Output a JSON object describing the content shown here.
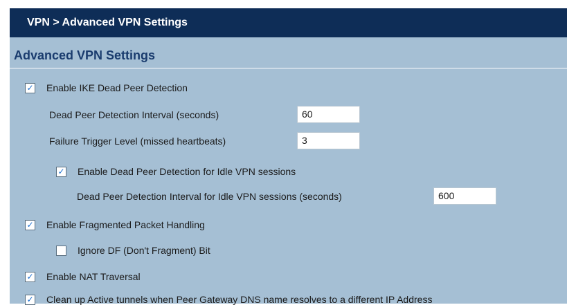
{
  "header": {
    "title": "VPN > Advanced VPN Settings"
  },
  "section": {
    "title": "Advanced VPN Settings"
  },
  "ike_dpd": {
    "label": "Enable IKE Dead Peer Detection",
    "checked": true,
    "check_glyph": "✓",
    "interval_label": "Dead Peer Detection Interval (seconds)",
    "interval_value": "60",
    "failure_label": "Failure Trigger Level (missed heartbeats)",
    "failure_value": "3"
  },
  "idle_dpd": {
    "label": "Enable Dead Peer Detection for Idle VPN sessions",
    "checked": true,
    "check_glyph": "✓",
    "interval_label": "Dead Peer Detection Interval for Idle VPN sessions (seconds)",
    "interval_value": "600"
  },
  "fragmented": {
    "label": "Enable Fragmented Packet Handling",
    "checked": true,
    "check_glyph": "✓"
  },
  "ignore_df": {
    "label": "Ignore DF (Don't Fragment) Bit",
    "checked": false,
    "check_glyph": ""
  },
  "nat": {
    "label": "Enable NAT Traversal",
    "checked": true,
    "check_glyph": "✓"
  },
  "cleanup": {
    "label": "Clean up Active tunnels when Peer Gateway DNS name resolves to a different IP Address",
    "checked": true,
    "check_glyph": "✓"
  }
}
